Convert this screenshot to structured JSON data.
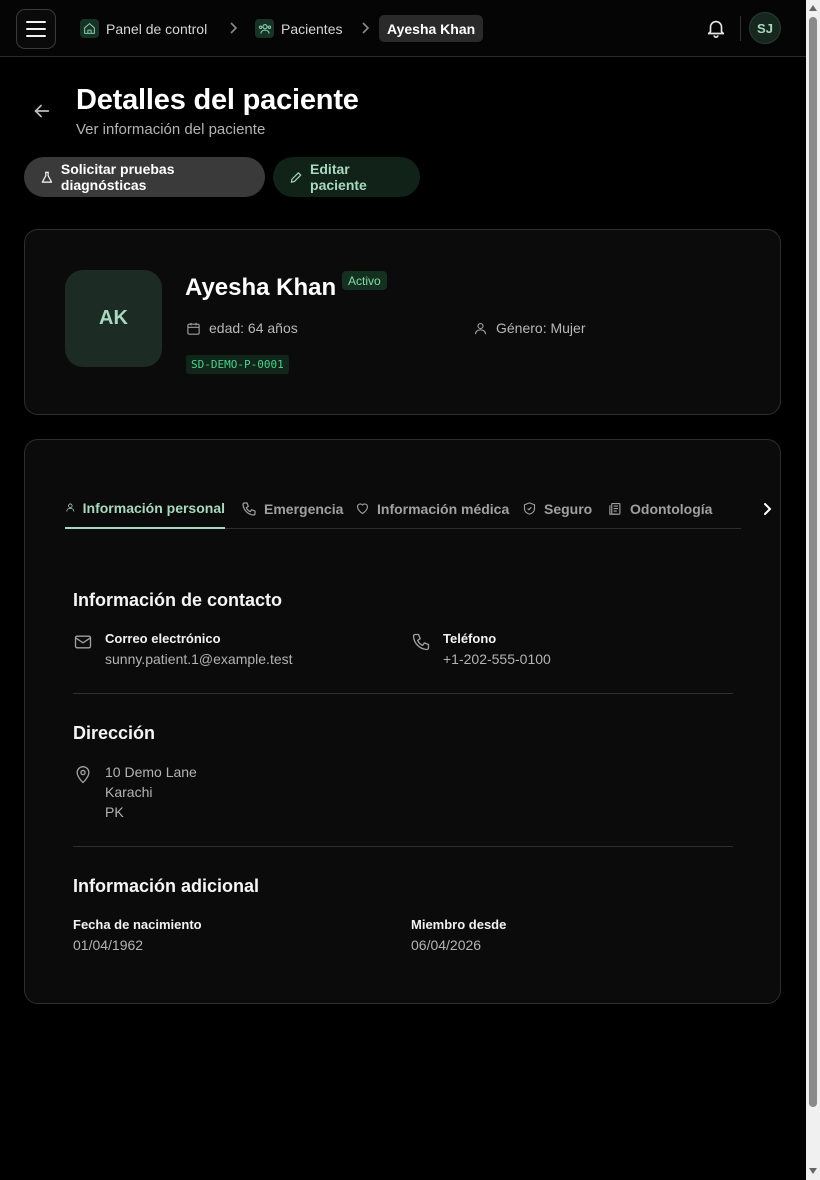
{
  "header": {
    "breadcrumbs": [
      {
        "label": "Panel de control",
        "icon": "home-icon"
      },
      {
        "label": "Pacientes",
        "icon": "users-icon"
      },
      {
        "label": "Ayesha Khan"
      }
    ],
    "user_initials": "SJ"
  },
  "page": {
    "title": "Detalles del paciente",
    "subtitle": "Ver información del paciente",
    "actions": {
      "diagnostics": "Solicitar pruebas diagnósticas",
      "edit": "Editar paciente"
    }
  },
  "patient": {
    "initials": "AK",
    "name": "Ayesha Khan",
    "status": "Activo",
    "age": "edad: 64 años",
    "gender": "Género: Mujer",
    "id": "SD-DEMO-P-0001"
  },
  "tabs": [
    {
      "label": "Información personal",
      "icon": "user-icon",
      "active": true
    },
    {
      "label": "Emergencia",
      "icon": "phone-icon"
    },
    {
      "label": "Información médica",
      "icon": "heart-icon"
    },
    {
      "label": "Seguro",
      "icon": "shield-icon"
    },
    {
      "label": "Odontología",
      "icon": "clipboard-icon"
    }
  ],
  "contact": {
    "title": "Información de contacto",
    "email_label": "Correo electrónico",
    "email": "sunny.patient.1@example.test",
    "phone_label": "Teléfono",
    "phone": "+1-202-555-0100"
  },
  "address": {
    "title": "Dirección",
    "line1": "10 Demo Lane",
    "city": "Karachi",
    "country": "PK"
  },
  "additional": {
    "title": "Información adicional",
    "dob_label": "Fecha de nacimiento",
    "dob": "01/04/1962",
    "member_label": "Miembro desde",
    "member_since": "06/04/2026"
  },
  "colors": {
    "accent": "#a8d8bd",
    "status_text": "#86dba9",
    "id_text": "#4fd08a",
    "background": "#000000",
    "card": "#0b0b0b"
  }
}
